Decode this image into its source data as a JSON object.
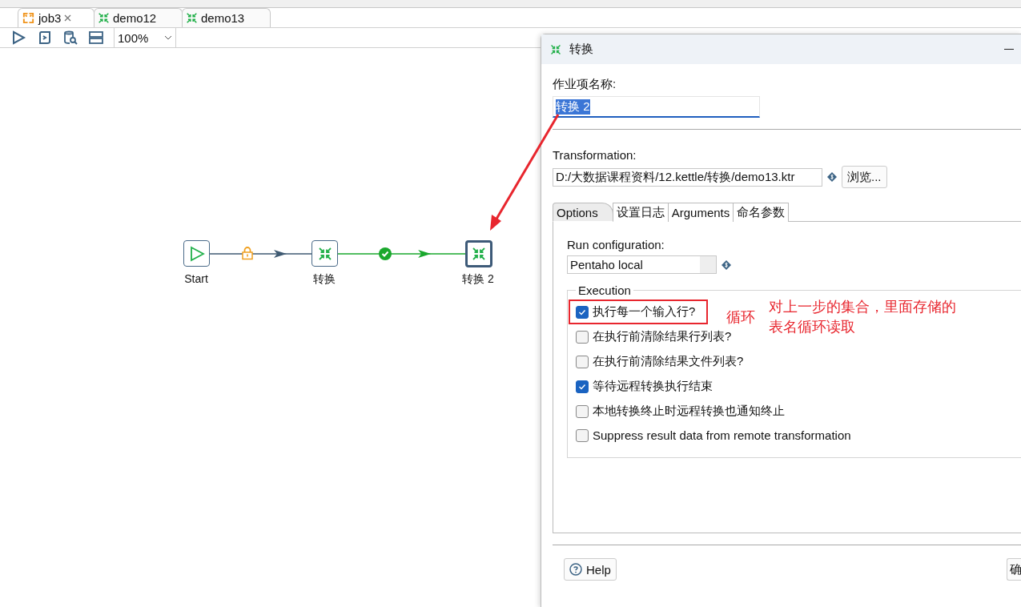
{
  "editor_tabs": [
    {
      "label": "job3",
      "kind": "job",
      "selected": true,
      "closable": true
    },
    {
      "label": "demo12",
      "kind": "transformation",
      "selected": false,
      "closable": false
    },
    {
      "label": "demo13",
      "kind": "transformation",
      "selected": false,
      "closable": false
    }
  ],
  "toolbar": {
    "zoom": "100%"
  },
  "canvas": {
    "nodes": [
      {
        "label": "Start",
        "kind": "start",
        "selected": false
      },
      {
        "label": "转换",
        "kind": "transformation",
        "selected": false
      },
      {
        "label": "转换 2",
        "kind": "transformation",
        "selected": true
      }
    ],
    "hops": [
      {
        "kind": "unconditional"
      },
      {
        "kind": "success"
      }
    ]
  },
  "dialog": {
    "title": "转换",
    "entry_name_label": "作业项名称:",
    "entry_name": "转换 2",
    "transformation_label": "Transformation:",
    "transformation_path": "D:/大数据课程资料/12.kettle/转换/demo13.ktr",
    "browse_button": "浏览...",
    "tabs": [
      {
        "label": "Options",
        "selected": true
      },
      {
        "label": "设置日志",
        "selected": false
      },
      {
        "label": "Arguments",
        "selected": false
      },
      {
        "label": "命名参数",
        "selected": false
      }
    ],
    "run_configuration_label": "Run configuration:",
    "run_configuration": "Pentaho local",
    "execution_label": "Execution",
    "options": [
      {
        "label": "执行每一个输入行?",
        "checked": true,
        "annotated": true
      },
      {
        "label": "在执行前清除结果行列表?",
        "checked": false,
        "annotated": false
      },
      {
        "label": "在执行前清除结果文件列表?",
        "checked": false,
        "annotated": false
      },
      {
        "label": "等待远程转换执行结束",
        "checked": true,
        "annotated": false
      },
      {
        "label": "本地转换终止时远程转换也通知终止",
        "checked": false,
        "annotated": false
      },
      {
        "label": "Suppress result data from remote transformation",
        "checked": false,
        "annotated": false
      }
    ],
    "help_button": "Help",
    "ok_button": "确"
  },
  "annotations": {
    "short_note": "循环",
    "long_note": "对上一步的集合，里面存储的表名循环读取"
  }
}
